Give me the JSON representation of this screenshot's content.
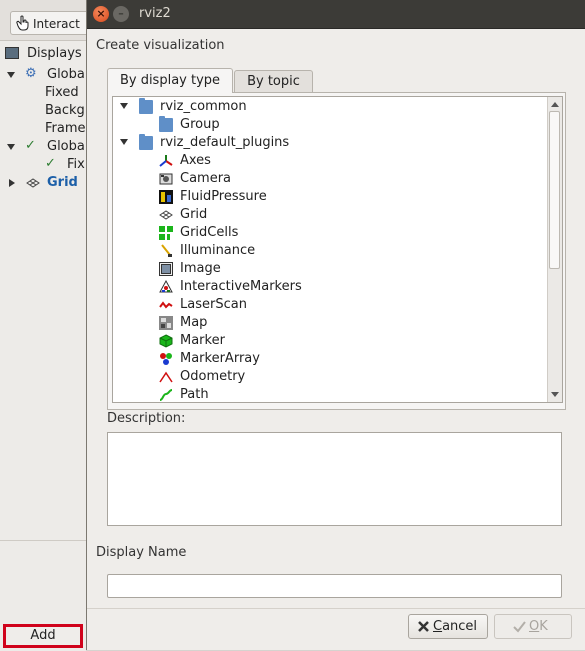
{
  "background_window": {
    "toolbar_button": "Interact",
    "displays_title": "Displays",
    "tree": [
      {
        "label": "Globa",
        "icon": "gear-icon",
        "expanded": true
      },
      {
        "label": "Fixed"
      },
      {
        "label": "Backg"
      },
      {
        "label": "Frame"
      },
      {
        "label": "Globa",
        "icon": "check-icon",
        "expanded": true
      },
      {
        "label": "Fix",
        "icon": "check-icon"
      },
      {
        "label": "Grid",
        "icon": "grid-icon",
        "expanded": false
      }
    ],
    "add_button": "Add"
  },
  "dialog": {
    "title": "rviz2",
    "section_create": "Create visualization",
    "tabs": [
      {
        "label": "By display type",
        "active": true
      },
      {
        "label": "By topic",
        "active": false
      }
    ],
    "tree": [
      {
        "label": "rviz_common",
        "type": "group",
        "icon": "folder-icon"
      },
      {
        "label": "Group",
        "type": "item",
        "icon": "folder-icon"
      },
      {
        "label": "rviz_default_plugins",
        "type": "group",
        "icon": "folder-icon"
      },
      {
        "label": "Axes",
        "type": "item",
        "icon": "axes-icon"
      },
      {
        "label": "Camera",
        "type": "item",
        "icon": "camera-icon"
      },
      {
        "label": "FluidPressure",
        "type": "item",
        "icon": "fluid-pressure-icon"
      },
      {
        "label": "Grid",
        "type": "item",
        "icon": "grid-icon"
      },
      {
        "label": "GridCells",
        "type": "item",
        "icon": "grid-cells-icon"
      },
      {
        "label": "Illuminance",
        "type": "item",
        "icon": "illuminance-icon"
      },
      {
        "label": "Image",
        "type": "item",
        "icon": "image-icon"
      },
      {
        "label": "InteractiveMarkers",
        "type": "item",
        "icon": "interactive-markers-icon"
      },
      {
        "label": "LaserScan",
        "type": "item",
        "icon": "laser-scan-icon"
      },
      {
        "label": "Map",
        "type": "item",
        "icon": "map-icon"
      },
      {
        "label": "Marker",
        "type": "item",
        "icon": "marker-icon"
      },
      {
        "label": "MarkerArray",
        "type": "item",
        "icon": "marker-array-icon"
      },
      {
        "label": "Odometry",
        "type": "item",
        "icon": "odometry-icon"
      },
      {
        "label": "Path",
        "type": "item",
        "icon": "path-icon"
      }
    ],
    "description_label": "Description:",
    "description_text": "",
    "display_name_label": "Display Name",
    "display_name_value": "",
    "cancel_button": {
      "prefix": "",
      "underlined": "C",
      "rest": "ancel"
    },
    "ok_button": {
      "underlined": "O",
      "rest": "K"
    },
    "colors": {
      "close": "#e95420",
      "titlebar": "#3c3b37",
      "highlight_box": "#d0021b"
    }
  }
}
